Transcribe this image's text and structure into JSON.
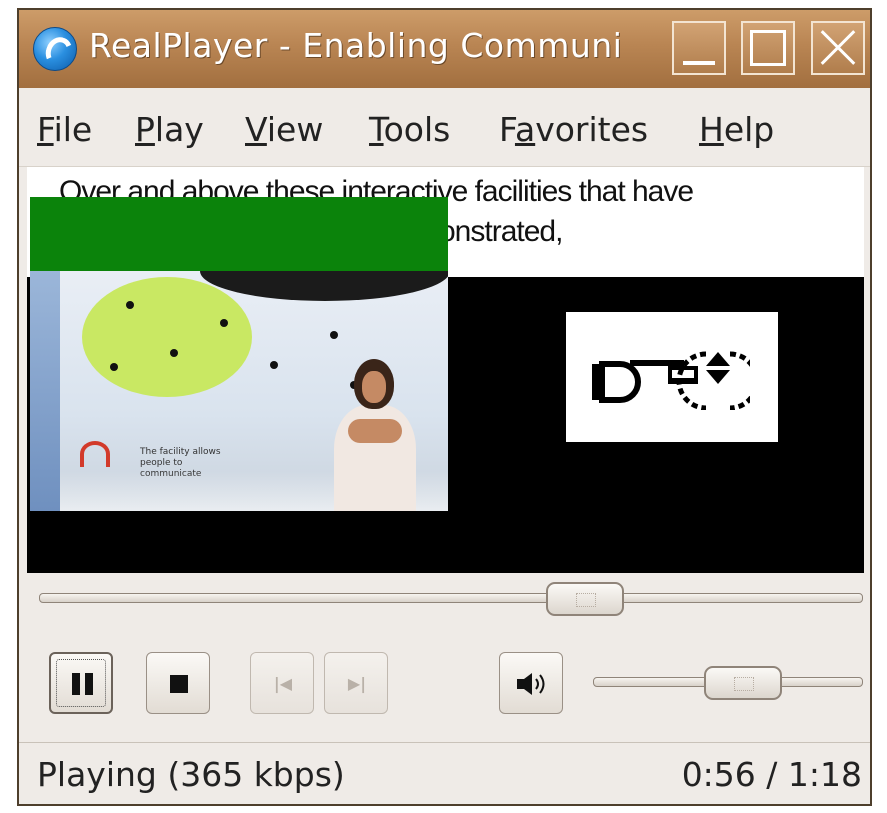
{
  "window": {
    "title": "RealPlayer - Enabling Communi",
    "controls": {
      "minimize": "minimize",
      "maximize": "maximize",
      "close": "close"
    }
  },
  "menu": {
    "items": [
      {
        "label": "File"
      },
      {
        "label": "Play"
      },
      {
        "label": "View"
      },
      {
        "label": "Tools"
      },
      {
        "label": "Favorites"
      },
      {
        "label": "Help"
      }
    ]
  },
  "video": {
    "caption_line1": "Over and above these interactive facilities that have",
    "caption_line2": "onstrated,",
    "inset_text": "The facility allows people to communicate"
  },
  "playback": {
    "seek_position_fraction": 0.68,
    "volume_fraction": 0.58,
    "buttons": {
      "pause": "pause",
      "stop": "stop",
      "previous": "previous",
      "next": "next",
      "volume": "volume"
    }
  },
  "status": {
    "state_text": "Playing (365 kbps)",
    "time_text": "0:56 / 1:18"
  },
  "colors": {
    "titlebar": "#b98553",
    "caption_overlay": "#0b830b",
    "video_bg": "#000000",
    "chrome_bg": "#efebe7"
  }
}
